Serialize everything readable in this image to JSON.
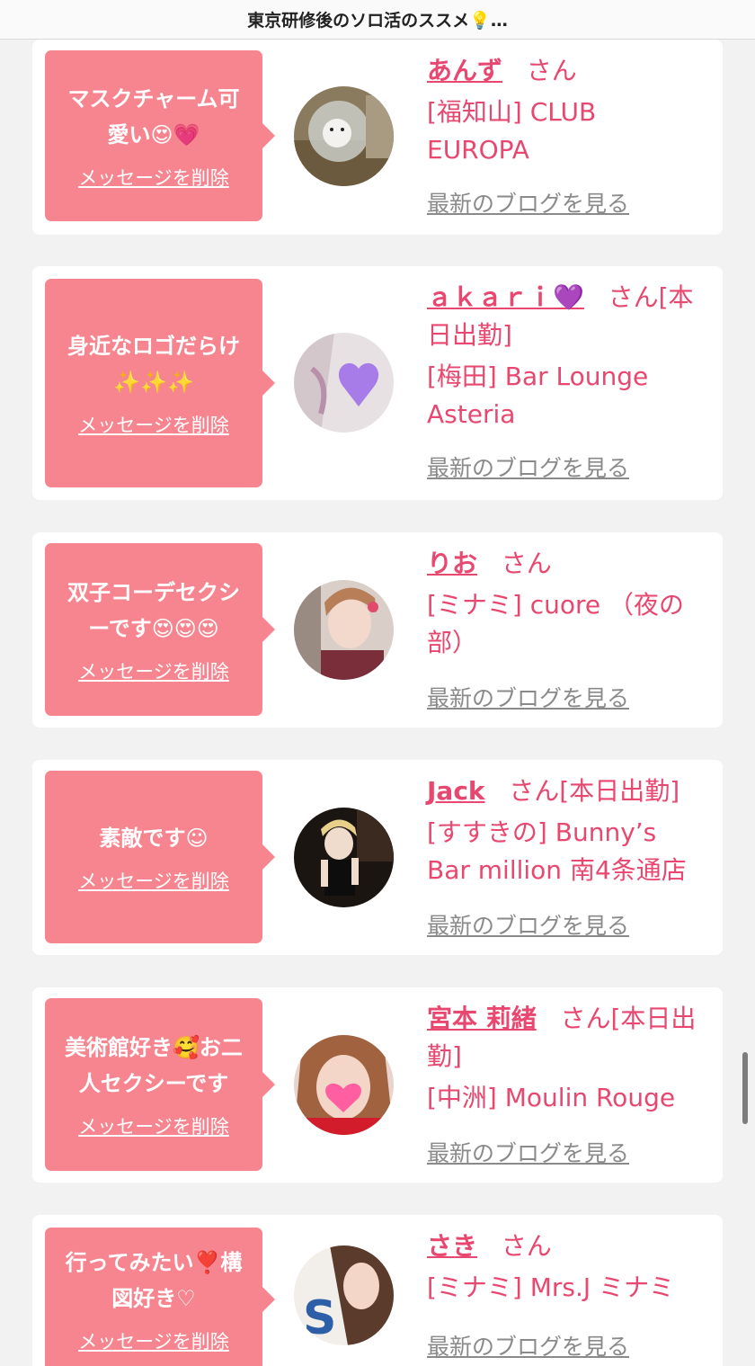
{
  "header": {
    "title": "東京研修後のソロ活のススメ💡…"
  },
  "delete_label": "メッセージを削除",
  "blog_label": "最新のブログを見る",
  "honorific": "さん",
  "cards": [
    {
      "msg_lines": [
        "マスクチャーム可",
        "愛い😍💗"
      ],
      "name": "あんず",
      "suffix": "",
      "shop_lines": [
        "[福知山] CLUB",
        "EUROPA"
      ]
    },
    {
      "msg_lines": [
        "身近なロゴだらけ",
        "✨✨✨"
      ],
      "name": "ａｋａｒｉ💜",
      "suffix": "[本日出勤]",
      "shop_lines": [
        "[梅田] Bar Lounge",
        "Asteria"
      ]
    },
    {
      "msg_lines": [
        "双子コーデセクシ",
        "ーです😍😍😍"
      ],
      "name": "りお",
      "suffix": "",
      "shop_lines": [
        "[ミナミ] cuore （夜の",
        "部）"
      ]
    },
    {
      "msg_lines": [
        "素敵です☺"
      ],
      "name": "Jack",
      "suffix": "[本日出勤]",
      "shop_lines": [
        "[すすきの] Bunny’s",
        "Bar million 南4条通店"
      ]
    },
    {
      "msg_lines": [
        "美術館好き🥰お二",
        "人セクシーです"
      ],
      "name": "宮本 莉緒",
      "suffix": "[本日出勤]",
      "shop_lines": [
        "[中洲] Moulin Rouge"
      ]
    },
    {
      "msg_lines": [
        "行ってみたい❣️構",
        "図好き♡"
      ],
      "name": "さき",
      "suffix": "",
      "shop_lines": [
        "[ミナミ] Mrs.J ミナミ"
      ]
    }
  ]
}
